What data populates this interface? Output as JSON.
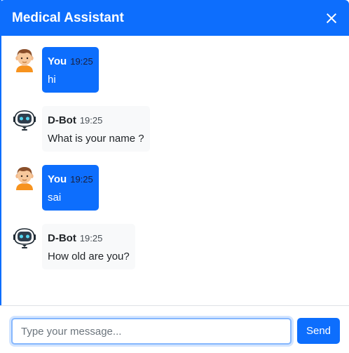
{
  "header": {
    "title": "Medical Assistant",
    "close_icon": "close-icon"
  },
  "messages": [
    {
      "role": "user",
      "sender": "You",
      "time": "19:25",
      "text": "hi",
      "avatar_icon": "user-avatar-icon"
    },
    {
      "role": "bot",
      "sender": "D-Bot",
      "time": "19:25",
      "text": "What is your name ?",
      "avatar_icon": "robot-avatar-icon"
    },
    {
      "role": "user",
      "sender": "You",
      "time": "19:25",
      "text": "sai",
      "avatar_icon": "user-avatar-icon"
    },
    {
      "role": "bot",
      "sender": "D-Bot",
      "time": "19:25",
      "text": "How old are you?",
      "avatar_icon": "robot-avatar-icon"
    }
  ],
  "footer": {
    "input_placeholder": "Type your message...",
    "input_value": "",
    "send_label": "Send"
  },
  "colors": {
    "accent": "#0d6efd",
    "bot_bubble": "#f8f9fa",
    "user_bubble": "#0d6efd"
  }
}
